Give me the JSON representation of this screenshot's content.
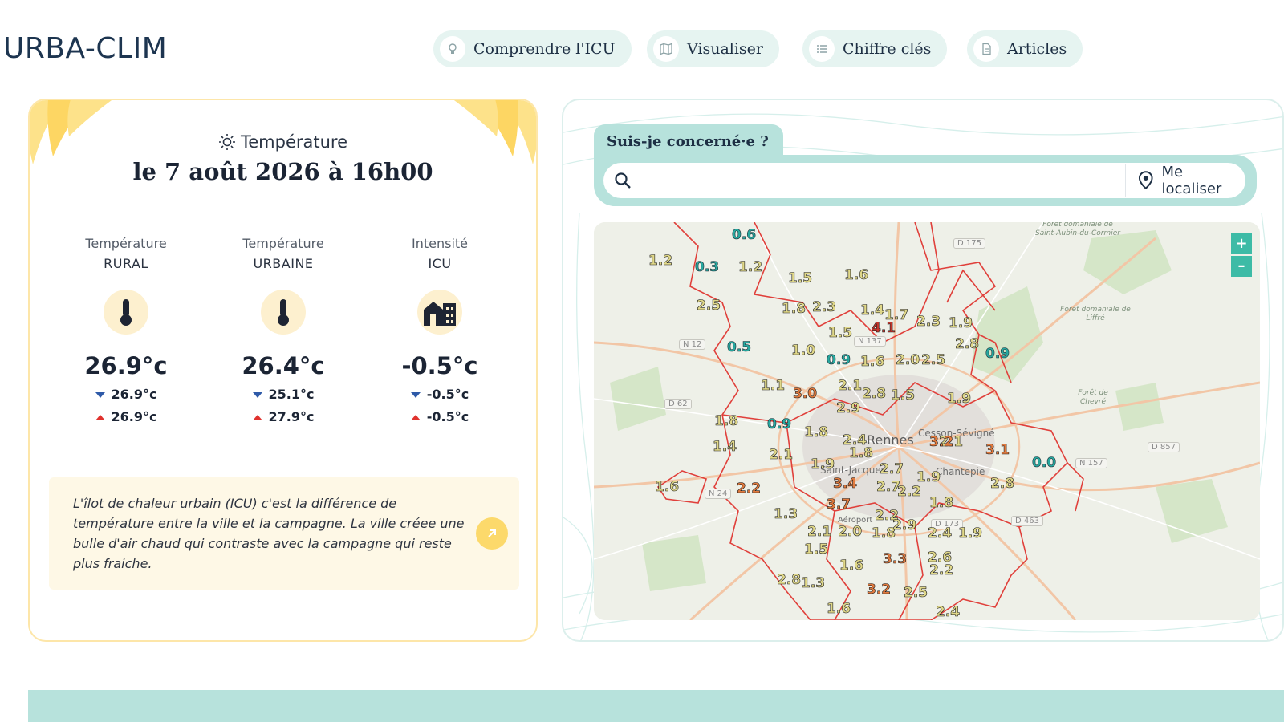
{
  "header": {
    "logo": "URBA-CLIM",
    "nav": [
      {
        "label": "Comprendre l'ICU",
        "icon": "lightbulb-icon"
      },
      {
        "label": "Visualiser",
        "icon": "map-icon"
      },
      {
        "label": "Chiffre clés",
        "icon": "list-icon"
      },
      {
        "label": "Articles",
        "icon": "document-icon"
      }
    ]
  },
  "temperature_card": {
    "title": "Température",
    "date": "le 7 août 2026 à 16h00",
    "columns": [
      {
        "h1": "Température",
        "h2": "RURAL",
        "icon": "thermometer-icon",
        "value": "26.9°c",
        "min": "26.9°c",
        "max": "26.9°c"
      },
      {
        "h1": "Température",
        "h2": "URBAINE",
        "icon": "thermometer-icon",
        "value": "26.4°c",
        "min": "25.1°c",
        "max": "27.9°c"
      },
      {
        "h1": "Intensité",
        "h2": "ICU",
        "icon": "buildings-icon",
        "value": "-0.5°c",
        "min": "-0.5°c",
        "max": "-0.5°c"
      }
    ],
    "info_text": "L'îlot de chaleur urbain (ICU) c'est la différence de température entre la ville et la campagne. La ville créee une bulle d'air chaud qui contraste avec la campagne qui reste plus fraiche.",
    "info_link_icon": "arrow-up-right-icon"
  },
  "map_card": {
    "tab_label": "Suis-je concerné·e ?",
    "search_placeholder": "",
    "locate_label": "Me localiser",
    "zoom_in": "+",
    "zoom_out": "–",
    "roads": [
      "D 175",
      "N 12",
      "D 62",
      "N 24",
      "D 857",
      "N 157",
      "D 463",
      "D 173",
      "N 137"
    ],
    "places": [
      "Rennes",
      "Cesson-Sévigné",
      "Saint-Jacques",
      "Chantepie",
      "Aéroport"
    ],
    "forests": [
      "Forêt domaniale de Saint-Aubin-du-Cormier",
      "Forêt domaniale de Liffré",
      "Forêt de Chevré"
    ],
    "values": [
      {
        "v": "0.6",
        "c": "lo"
      },
      {
        "v": "1.2",
        "c": "mid"
      },
      {
        "v": "0.3",
        "c": "lo"
      },
      {
        "v": "1.2",
        "c": "mid"
      },
      {
        "v": "1.5",
        "c": "mid"
      },
      {
        "v": "1.6",
        "c": "mid"
      },
      {
        "v": "2.5",
        "c": "mid"
      },
      {
        "v": "1.8",
        "c": "mid"
      },
      {
        "v": "2.3",
        "c": "mid"
      },
      {
        "v": "1.4",
        "c": "mid"
      },
      {
        "v": "1.7",
        "c": "mid"
      },
      {
        "v": "4.1",
        "c": "vhi"
      },
      {
        "v": "2.3",
        "c": "mid"
      },
      {
        "v": "1.9",
        "c": "mid"
      },
      {
        "v": "1.5",
        "c": "mid"
      },
      {
        "v": "2.8",
        "c": "mid"
      },
      {
        "v": "0.5",
        "c": "lo"
      },
      {
        "v": "1.0",
        "c": "mid"
      },
      {
        "v": "0.9",
        "c": "lo"
      },
      {
        "v": "1.6",
        "c": "mid"
      },
      {
        "v": "2.0",
        "c": "mid"
      },
      {
        "v": "2.5",
        "c": "mid"
      },
      {
        "v": "0.9",
        "c": "lo"
      },
      {
        "v": "1.1",
        "c": "mid"
      },
      {
        "v": "3.0",
        "c": "hi"
      },
      {
        "v": "2.1",
        "c": "mid"
      },
      {
        "v": "2.8",
        "c": "mid"
      },
      {
        "v": "1.5",
        "c": "mid"
      },
      {
        "v": "1.9",
        "c": "mid"
      },
      {
        "v": "2.9",
        "c": "mid"
      },
      {
        "v": "1.8",
        "c": "mid"
      },
      {
        "v": "0.9",
        "c": "lo"
      },
      {
        "v": "1.8",
        "c": "mid"
      },
      {
        "v": "2.4",
        "c": "mid"
      },
      {
        "v": "2.1",
        "c": "mid"
      },
      {
        "v": "1.4",
        "c": "mid"
      },
      {
        "v": "2.1",
        "c": "mid"
      },
      {
        "v": "1.8",
        "c": "mid"
      },
      {
        "v": "3.2",
        "c": "hi"
      },
      {
        "v": "3.1",
        "c": "hi"
      },
      {
        "v": "0.0",
        "c": "lo"
      },
      {
        "v": "1.9",
        "c": "mid"
      },
      {
        "v": "2.8",
        "c": "mid"
      },
      {
        "v": "1.9",
        "c": "mid"
      },
      {
        "v": "1.6",
        "c": "mid"
      },
      {
        "v": "2.2",
        "c": "hi"
      },
      {
        "v": "3.4",
        "c": "hi"
      },
      {
        "v": "2.7",
        "c": "mid"
      },
      {
        "v": "2.2",
        "c": "mid"
      },
      {
        "v": "2.7",
        "c": "mid"
      },
      {
        "v": "1.3",
        "c": "mid"
      },
      {
        "v": "3.7",
        "c": "hi"
      },
      {
        "v": "1.8",
        "c": "mid"
      },
      {
        "v": "2.2",
        "c": "mid"
      },
      {
        "v": "2.1",
        "c": "mid"
      },
      {
        "v": "2.0",
        "c": "mid"
      },
      {
        "v": "1.8",
        "c": "mid"
      },
      {
        "v": "2.9",
        "c": "mid"
      },
      {
        "v": "2.4",
        "c": "mid"
      },
      {
        "v": "1.9",
        "c": "mid"
      },
      {
        "v": "1.5",
        "c": "mid"
      },
      {
        "v": "1.6",
        "c": "mid"
      },
      {
        "v": "3.3",
        "c": "hi"
      },
      {
        "v": "2.6",
        "c": "mid"
      },
      {
        "v": "2.2",
        "c": "mid"
      },
      {
        "v": "2.8",
        "c": "mid"
      },
      {
        "v": "1.3",
        "c": "mid"
      },
      {
        "v": "3.2",
        "c": "hi"
      },
      {
        "v": "2.5",
        "c": "mid"
      },
      {
        "v": "1.6",
        "c": "mid"
      },
      {
        "v": "2.4",
        "c": "mid"
      }
    ]
  },
  "colors": {
    "accent_teal": "#b7e2dc",
    "nav_bg": "#e6f4f1",
    "card_border_yellow": "#fde6a9",
    "info_bg": "#fef8e6",
    "info_button": "#fcd96b",
    "zoom_button": "#3dbba6",
    "boundary_red": "#e0403b"
  }
}
